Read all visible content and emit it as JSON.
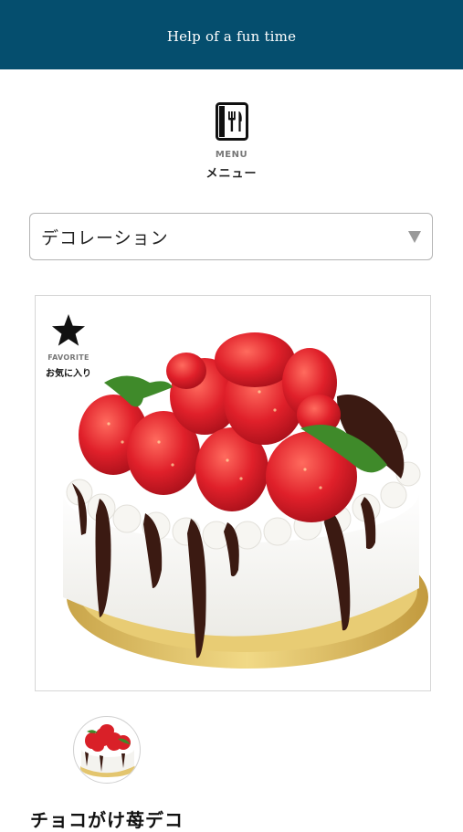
{
  "header": {
    "title": "Help of a fun time",
    "background_color": "#054e6e"
  },
  "menu": {
    "icon": "fork-knife-menu-icon",
    "label_en": "MENU",
    "label_ja": "メニュー"
  },
  "category_select": {
    "selected": "デコレーション",
    "arrow_icon": "triangle-down-icon"
  },
  "product": {
    "image_description_icon": "strawberry-chocolate-cake-image",
    "favorite": {
      "icon": "star-icon",
      "label_en": "FAVORITE",
      "label_ja": "お気に入り"
    },
    "name": "チョコがけ苺デコ"
  }
}
